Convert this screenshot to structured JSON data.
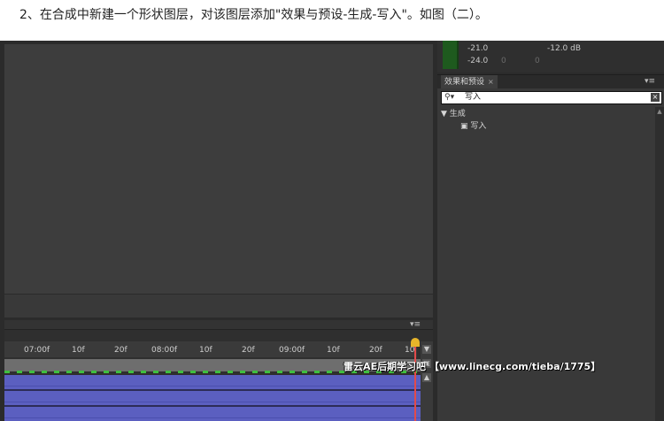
{
  "caption": "2、在合成中新建一个形状图层，对该图层添加\"效果与预设-生成-写入\"。如图（二）。",
  "audio": {
    "levels_left": [
      "-21.0",
      "-24.0"
    ],
    "db_readout": "-12.0 dB",
    "zeros": [
      "0",
      "0"
    ]
  },
  "effects_panel": {
    "tab_label": "效果和预设",
    "tab_close": "×",
    "menu": "▾≡",
    "search_value": "写入",
    "search_icon": "search-icon",
    "clear": "×",
    "category": "生成",
    "category_arrow": "▼",
    "item": "写入"
  },
  "timeline": {
    "menu": "▾≡",
    "ticks": [
      "07:00f",
      "10f",
      "20f",
      "08:00f",
      "10f",
      "20f",
      "09:00f",
      "10f",
      "20f",
      "10"
    ]
  },
  "watermark": "雷云AE后期学习吧  【www.linecg.com/tieba/1775】",
  "colors": {
    "track_blue": "#5b5fc0",
    "keyframe_green": "#3fbf3f",
    "cti_yellow": "#e7b52a"
  }
}
